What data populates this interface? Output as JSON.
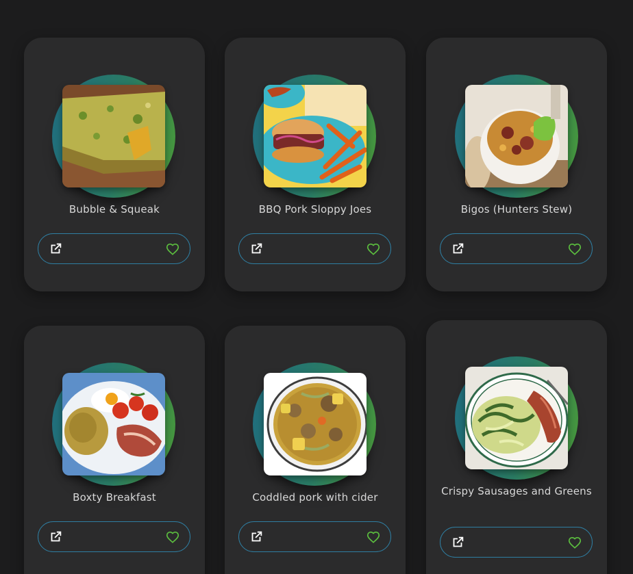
{
  "colors": {
    "page_background": "#1c1c1d",
    "card_background": "#2b2b2c",
    "ring_gradient": [
      "#1f6d80",
      "#4a9a38"
    ],
    "action_border": "#2f7fa3",
    "heart": "#5cbf3f"
  },
  "recipes": [
    {
      "title": "Bubble & Squeak",
      "open_icon": "open-in-new-icon",
      "favorite_icon": "heart-outline-icon"
    },
    {
      "title": "BBQ Pork Sloppy Joes",
      "open_icon": "open-in-new-icon",
      "favorite_icon": "heart-outline-icon"
    },
    {
      "title": "Bigos (Hunters Stew)",
      "open_icon": "open-in-new-icon",
      "favorite_icon": "heart-outline-icon"
    },
    {
      "title": "Boxty Breakfast",
      "open_icon": "open-in-new-icon",
      "favorite_icon": "heart-outline-icon"
    },
    {
      "title": "Coddled pork with cider",
      "open_icon": "open-in-new-icon",
      "favorite_icon": "heart-outline-icon"
    },
    {
      "title": "Crispy Sausages and Greens",
      "open_icon": "open-in-new-icon",
      "favorite_icon": "heart-outline-icon"
    }
  ]
}
